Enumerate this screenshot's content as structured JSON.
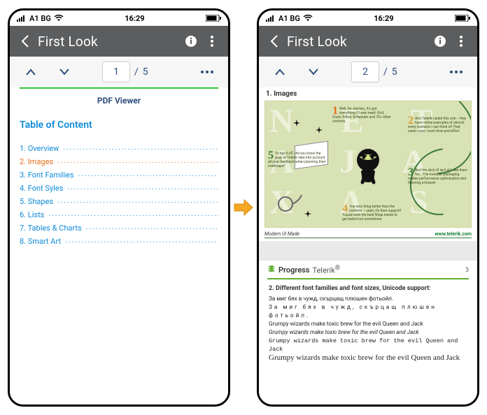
{
  "statusbar": {
    "carrier": "A1 BG",
    "time": "16:29"
  },
  "header": {
    "title": "First Look"
  },
  "toolbar_left": {
    "current_page": "1",
    "separator": "/",
    "total_pages": "5"
  },
  "toolbar_right": {
    "current_page": "2",
    "separator": "/",
    "total_pages": "5"
  },
  "page1": {
    "title": "PDF Viewer",
    "toc_title": "Table of Content",
    "items": [
      "1. Overview",
      "2. Images",
      "3. Font Families",
      "4. Font Syles",
      "5. Shapes",
      "6. Lists",
      "7. Tables & Charts",
      "8. Smart Art"
    ],
    "active_index": 1
  },
  "page2": {
    "section1_heading": "1. Images",
    "callouts": {
      "c1": {
        "num": "1",
        "text": "Well, for starters, it's got everything I'll ever need: Grid, Chart, Editor, Scheduler and 70+ other controls."
      },
      "c2": {
        "num": "2",
        "text": "And Telerik nailed this one – they have online examples of almost every scenario I can think of! That saves sooo much time and effort."
      },
      "c3": {
        "num": "3",
        "text": "And the slick UI isn't all I like them for... The modular packaging makes performance optimization and theming a breeze!"
      },
      "c4": {
        "num": "4",
        "text": "The only thing better than the controls — yeah, it's their support! 'Cause even the best Ninja needs to get bailed out sometimes."
      },
      "c5": {
        "num": "5",
        "text": "To top it off, did you know the guys at Telerik take into account all your feedback when planning their roadmaps?"
      }
    },
    "footer_left": "Modern UI Made",
    "footer_right": "www.telerik.com",
    "brand_main": "Progress",
    "brand_sub": "Telerik",
    "brand_page": "3",
    "section2_heading": "2. Different font families and font sizes, Unicode support:",
    "samples": {
      "s1": "За миг бях в чужд, скърцащ плюшен фотьойл.",
      "s2": "За миг бях в чужд, скърцащ плюшен фотьойл.",
      "s3": "Grumpy wizards make toxic brew for the evil Queen and Jack",
      "s4": "Grumpy wizards make toxic brew for the evil Queen and Jack",
      "s5": "Grumpy wizards make toxic brew for the evil Queen and Jack",
      "s6": "Grumpy wizards make toxic brew for the evil Queen and Jack"
    }
  }
}
